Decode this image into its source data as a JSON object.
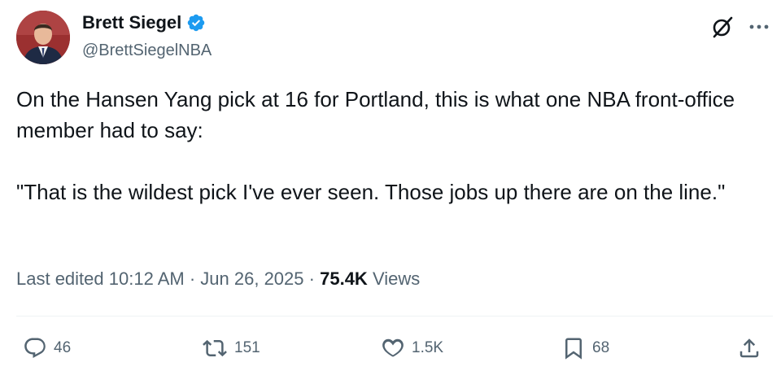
{
  "author": {
    "display_name": "Brett Siegel",
    "handle": "@BrettSiegelNBA",
    "verified": true
  },
  "tweet": {
    "paragraphs": [
      "On the Hansen Yang pick at 16 for Portland, this is what one NBA front-office member had to say:",
      "\"That is the wildest pick I've ever seen. Those jobs up there are on the line.\""
    ],
    "edited_label": "Last edited",
    "time": "10:12 AM",
    "separator": "·",
    "date": "Jun 26, 2025",
    "views_count": "75.4K",
    "views_label": "Views"
  },
  "actions": {
    "replies": "46",
    "reposts": "151",
    "likes": "1.5K",
    "bookmarks": "68"
  },
  "icons": {
    "verified": "verified-badge-icon",
    "grok": "grok-icon",
    "more": "more-icon",
    "reply": "reply-icon",
    "repost": "repost-icon",
    "like": "heart-icon",
    "bookmark": "bookmark-icon",
    "share": "share-icon"
  },
  "colors": {
    "text_primary": "#0f1419",
    "text_secondary": "#536471",
    "verified_blue": "#1d9bf0",
    "divider": "#eff3f4"
  }
}
